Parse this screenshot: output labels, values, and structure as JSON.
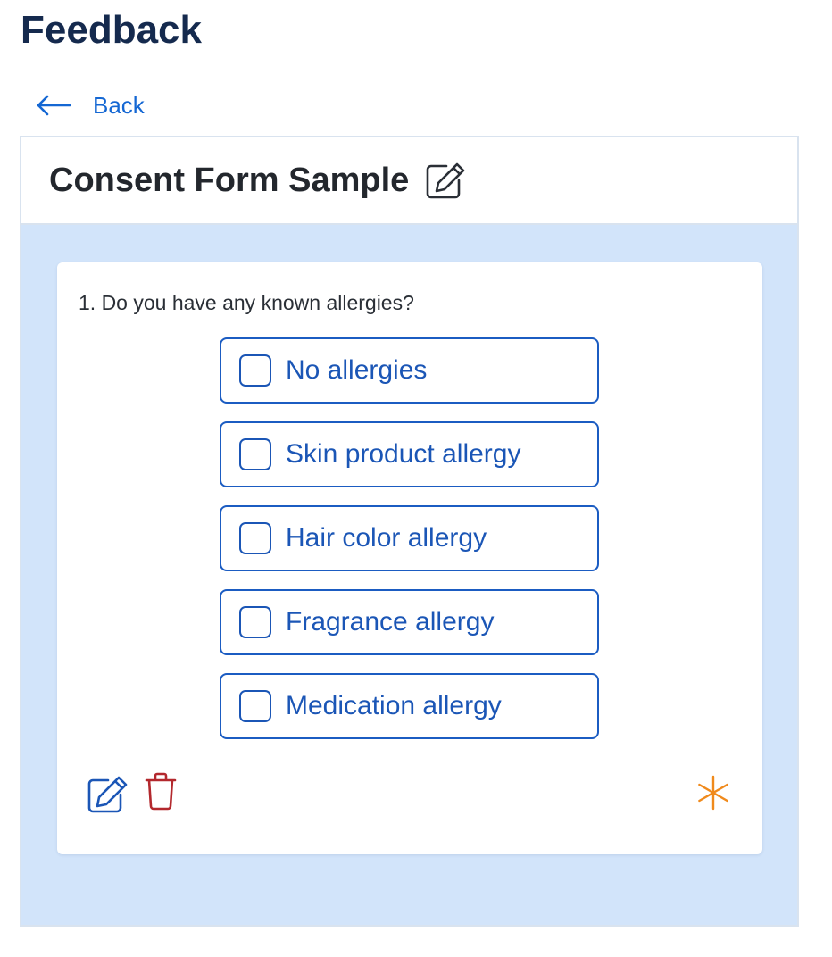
{
  "page": {
    "title": "Feedback"
  },
  "nav": {
    "back_label": "Back",
    "back_icon": "arrow-left-icon"
  },
  "form": {
    "title": "Consent Form Sample",
    "title_edit_icon": "edit-icon"
  },
  "question": {
    "text": "1. Do you have any known allergies?",
    "options": [
      {
        "label": "No allergies",
        "checked": false
      },
      {
        "label": "Skin product allergy",
        "checked": false
      },
      {
        "label": "Hair color allergy",
        "checked": false
      },
      {
        "label": "Fragrance allergy",
        "checked": false
      },
      {
        "label": "Medication allergy",
        "checked": false
      }
    ],
    "actions": {
      "edit_icon": "edit-icon",
      "delete_icon": "trash-icon"
    },
    "required_icon": "asterisk-icon"
  },
  "colors": {
    "title": "#152a4e",
    "link": "#1467d3",
    "panel_background": "#d2e4fa",
    "option": "#1b56b6",
    "delete": "#b3282d",
    "required": "#f08a1c"
  }
}
